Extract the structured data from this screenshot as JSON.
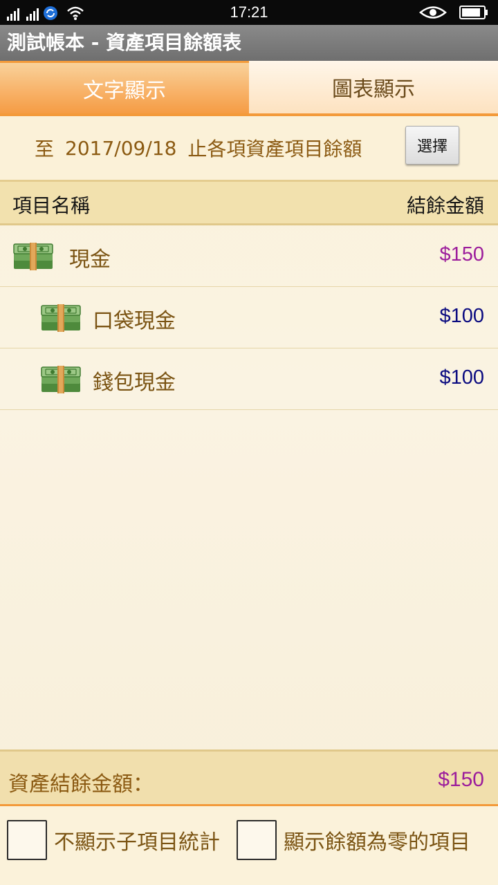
{
  "status_bar": {
    "time": "17:21"
  },
  "app": {
    "title": "測試帳本 - 資產項目餘額表"
  },
  "tabs": [
    {
      "label": "文字顯示",
      "active": true
    },
    {
      "label": "圖表顯示",
      "active": false
    }
  ],
  "date_row": {
    "prefix": "至",
    "date": "2017/09/18",
    "suffix": "止各項資產項目餘額",
    "select_label": "選擇"
  },
  "table": {
    "col_name": "項目名稱",
    "col_balance": "結餘金額",
    "rows": [
      {
        "name": "現金",
        "amount": "$150",
        "level": 0,
        "amount_color": "#9c1d9c",
        "icon": "cash-icon"
      },
      {
        "name": "口袋現金",
        "amount": "$100",
        "level": 1,
        "amount_color": "#0b0b80",
        "icon": "cash-icon"
      },
      {
        "name": "錢包現金",
        "amount": "$100",
        "level": 1,
        "amount_color": "#0b0b80",
        "icon": "cash-icon"
      }
    ]
  },
  "total": {
    "label": "資產結餘金額：",
    "value": "$150"
  },
  "options": {
    "hide_sub_stats": {
      "label": "不顯示子項目統計",
      "checked": false
    },
    "show_zero_balance": {
      "label": "顯示餘額為零的項目",
      "checked": false
    }
  },
  "colors": {
    "accent_orange": "#f39a3a",
    "positive_purple": "#9c1d9c",
    "sub_amount_navy": "#0b0b80",
    "text_brown": "#7a5312"
  }
}
